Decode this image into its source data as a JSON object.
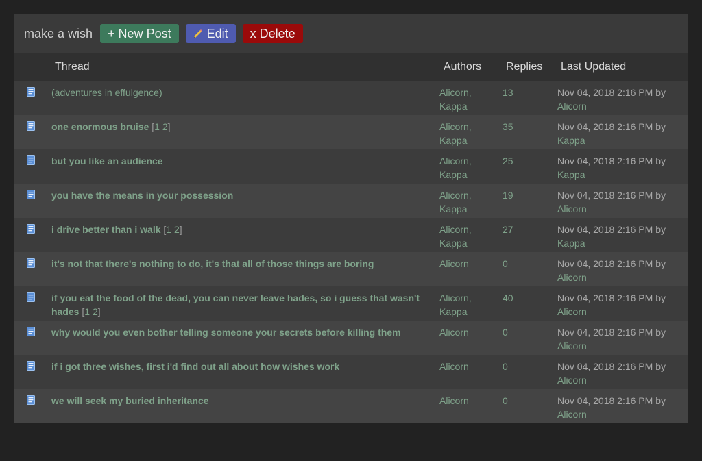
{
  "header": {
    "board_title": "make a wish",
    "new_post_label": "+ New Post",
    "edit_label": "Edit",
    "delete_label": "x Delete"
  },
  "columns": {
    "thread": "Thread",
    "authors": "Authors",
    "replies": "Replies",
    "last_updated": "Last Updated"
  },
  "threads": [
    {
      "title": "(adventures in effulgence)",
      "pages": [],
      "authors": [
        "Alicorn",
        "Kappa"
      ],
      "replies": "13",
      "updated": "Nov 04, 2018 2:16 PM by",
      "updated_by": "Alicorn"
    },
    {
      "title": "one enormous bruise",
      "pages": [
        "1",
        "2"
      ],
      "authors": [
        "Alicorn",
        "Kappa"
      ],
      "replies": "35",
      "updated": "Nov 04, 2018 2:16 PM by",
      "updated_by": "Kappa"
    },
    {
      "title": "but you like an audience",
      "pages": [],
      "authors": [
        "Alicorn",
        "Kappa"
      ],
      "replies": "25",
      "updated": "Nov 04, 2018 2:16 PM by",
      "updated_by": "Kappa"
    },
    {
      "title": "you have the means in your possession",
      "pages": [],
      "authors": [
        "Alicorn",
        "Kappa"
      ],
      "replies": "19",
      "updated": "Nov 04, 2018 2:16 PM by",
      "updated_by": "Alicorn"
    },
    {
      "title": "i drive better than i walk",
      "pages": [
        "1",
        "2"
      ],
      "authors": [
        "Alicorn",
        "Kappa"
      ],
      "replies": "27",
      "updated": "Nov 04, 2018 2:16 PM by",
      "updated_by": "Kappa"
    },
    {
      "title": "it's not that there's nothing to do, it's that all of those things are boring",
      "pages": [],
      "authors": [
        "Alicorn"
      ],
      "replies": "0",
      "updated": "Nov 04, 2018 2:16 PM by",
      "updated_by": "Alicorn"
    },
    {
      "title": "if you eat the food of the dead, you can never leave hades, so i guess that wasn't hades",
      "pages": [
        "1",
        "2"
      ],
      "authors": [
        "Alicorn",
        "Kappa"
      ],
      "replies": "40",
      "updated": "Nov 04, 2018 2:16 PM by",
      "updated_by": "Alicorn"
    },
    {
      "title": "why would you even bother telling someone your secrets before killing them",
      "pages": [],
      "authors": [
        "Alicorn"
      ],
      "replies": "0",
      "updated": "Nov 04, 2018 2:16 PM by",
      "updated_by": "Alicorn"
    },
    {
      "title": "if i got three wishes, first i'd find out all about how wishes work",
      "pages": [],
      "authors": [
        "Alicorn"
      ],
      "replies": "0",
      "updated": "Nov 04, 2018 2:16 PM by",
      "updated_by": "Alicorn"
    },
    {
      "title": "we will seek my buried inheritance",
      "pages": [],
      "authors": [
        "Alicorn"
      ],
      "replies": "0",
      "updated": "Nov 04, 2018 2:16 PM by",
      "updated_by": "Alicorn"
    }
  ],
  "icons": {
    "thread_icon": "book-icon",
    "edit_icon": "pencil-icon"
  },
  "colors": {
    "background": "#222222",
    "panel": "#303030",
    "link": "#7fa28a",
    "new_post_button": "#3d7a5c",
    "edit_button": "#4f5bb0",
    "delete_button": "#9a0a0a"
  }
}
